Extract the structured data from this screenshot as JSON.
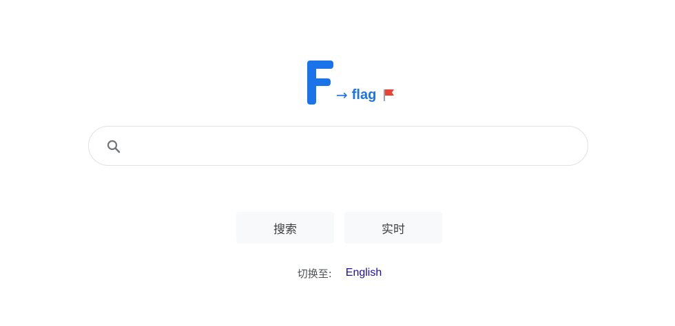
{
  "logo": {
    "letter": "F",
    "arrow": "→",
    "word": "flag",
    "flag_icon": "red-flag-icon",
    "color": "#1a73e8"
  },
  "search": {
    "value": "",
    "placeholder": "",
    "icon": "search-icon"
  },
  "buttons": {
    "search_label": "搜索",
    "realtime_label": "实时"
  },
  "language": {
    "label": "切换至:",
    "link_label": "English",
    "link_color": "#1a0dab"
  }
}
